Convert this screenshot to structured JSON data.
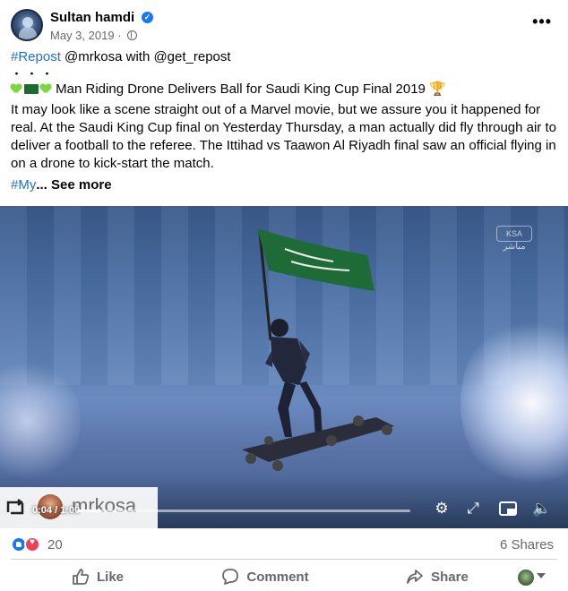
{
  "post": {
    "author": "Sultan hamdi",
    "date": "May 3, 2019",
    "meta_separator": "·",
    "hashtag_repost": "#Repost",
    "repost_line_rest": " @mrkosa with @get_repost",
    "dots": "・・・",
    "headline": " Man Riding Drone Delivers Ball for Saudi King Cup Final 2019 ",
    "body": "It may look like a scene straight out of a Marvel movie, but we assure you it happened for real. At the Saudi King Cup final on Yesterday Thursday, a man actually did fly through air to deliver a football to the referee. The Ittihad vs Taawon Al Riyadh final saw an official flying in on a drone to kick-start the match.",
    "hashtag_my": "#My",
    "see_more": "... See more"
  },
  "video": {
    "repost_name": "mrkosa",
    "time": "0:04 / 1:00",
    "progress": 0.07,
    "watermark": "KSA",
    "watermark_sub": "مباشر"
  },
  "reactions": {
    "count": "20",
    "shares": "6 Shares"
  },
  "actions": {
    "like": "Like",
    "comment": "Comment",
    "share": "Share"
  },
  "colors": {
    "accent": "#1877f2",
    "hashtag": "#216fdb",
    "love": "#f33e58",
    "flag_green": "#1e6b32"
  },
  "icons": {
    "verified": "verified-badge-icon",
    "globe": "globe-icon",
    "more": "more-options-icon",
    "settings": "gear-icon",
    "fullscreen": "fullscreen-icon",
    "pip": "picture-in-picture-icon",
    "volume": "volume-icon",
    "like": "thumbs-up-icon",
    "comment": "comment-icon",
    "share": "share-arrow-icon"
  }
}
